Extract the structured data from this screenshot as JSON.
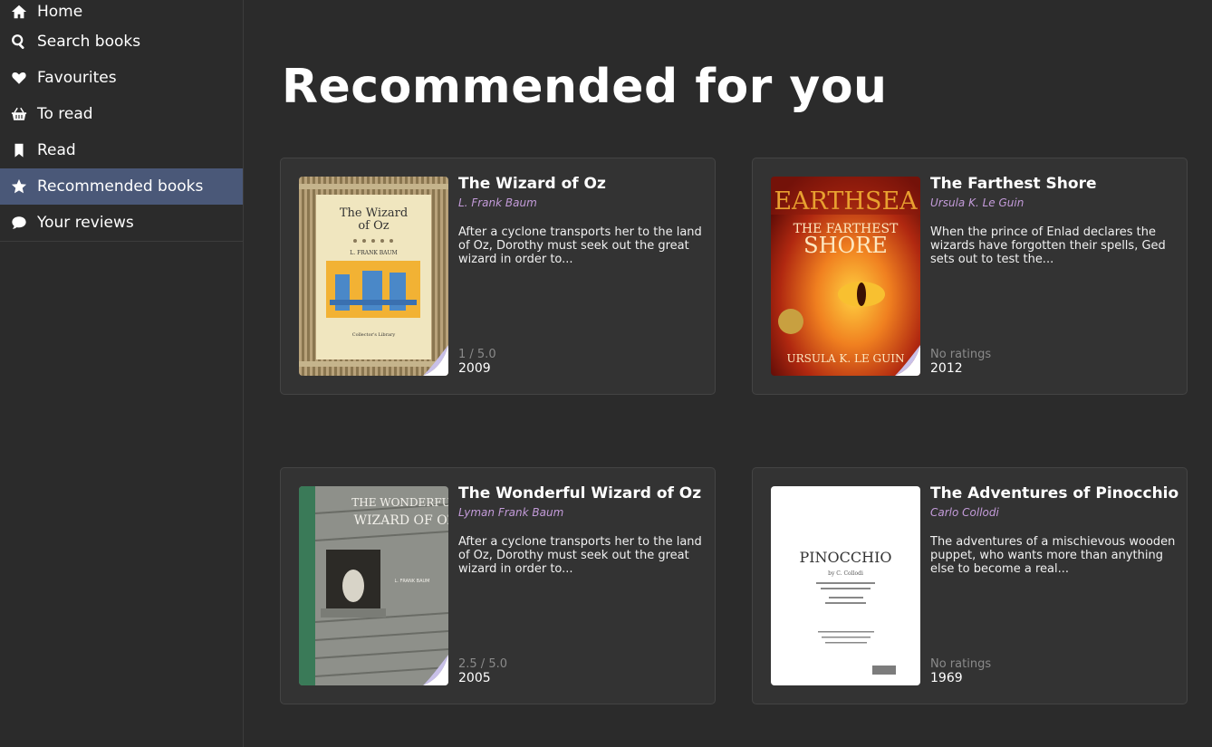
{
  "nav": [
    {
      "label": "Home",
      "icon": "home-icon",
      "active": false
    },
    {
      "label": "Search books",
      "icon": "search-icon",
      "active": false
    },
    {
      "label": "Favourites",
      "icon": "heart-icon",
      "active": false
    },
    {
      "label": "To read",
      "icon": "basket-icon",
      "active": false
    },
    {
      "label": "Read",
      "icon": "bookmark-icon",
      "active": false
    },
    {
      "label": "Recommended books",
      "icon": "star-icon",
      "active": true
    },
    {
      "label": "Your reviews",
      "icon": "comment-icon",
      "active": false
    }
  ],
  "page": {
    "title": "Recommended for you"
  },
  "books": [
    {
      "title": "The Wizard of Oz",
      "author": "L. Frank Baum",
      "description": "After a cyclone transports her to the land of Oz, Dorothy must seek out the great wizard in order to...",
      "rating": "1 / 5.0",
      "year": "2009",
      "cover": {
        "line1": "The Wizard",
        "line2": "of Oz",
        "author": "L. FRANK BAUM",
        "footer": "Collector's Library"
      }
    },
    {
      "title": "The Farthest Shore",
      "author": "Ursula K. Le Guin",
      "description": "When the prince of Enlad declares the wizards have forgotten their spells, Ged sets out to test the...",
      "rating": "No ratings",
      "year": "2012",
      "cover": {
        "series": "EARTHSEA",
        "line1": "THE FARTHEST",
        "line2": "SHORE",
        "author": "URSULA K. LE GUIN"
      }
    },
    {
      "title": "The Wonderful Wizard of Oz",
      "author": "Lyman Frank Baum",
      "description": "After a cyclone transports her to the land of Oz, Dorothy must seek out the great wizard in order to...",
      "rating": "2.5 / 5.0",
      "year": "2005",
      "cover": {
        "line1": "THE WONDERFUL",
        "line2": "WIZARD OF OZ",
        "author": "L. FRANK BAUM"
      }
    },
    {
      "title": "The Adventures of Pinocchio",
      "author": "Carlo Collodi",
      "description": "The adventures of a mischievous wooden puppet, who wants more than anything else to become a real...",
      "rating": "No ratings",
      "year": "1969",
      "cover": {
        "line1": "PINOCCHIO",
        "line2": "by C. Collodi"
      }
    }
  ]
}
